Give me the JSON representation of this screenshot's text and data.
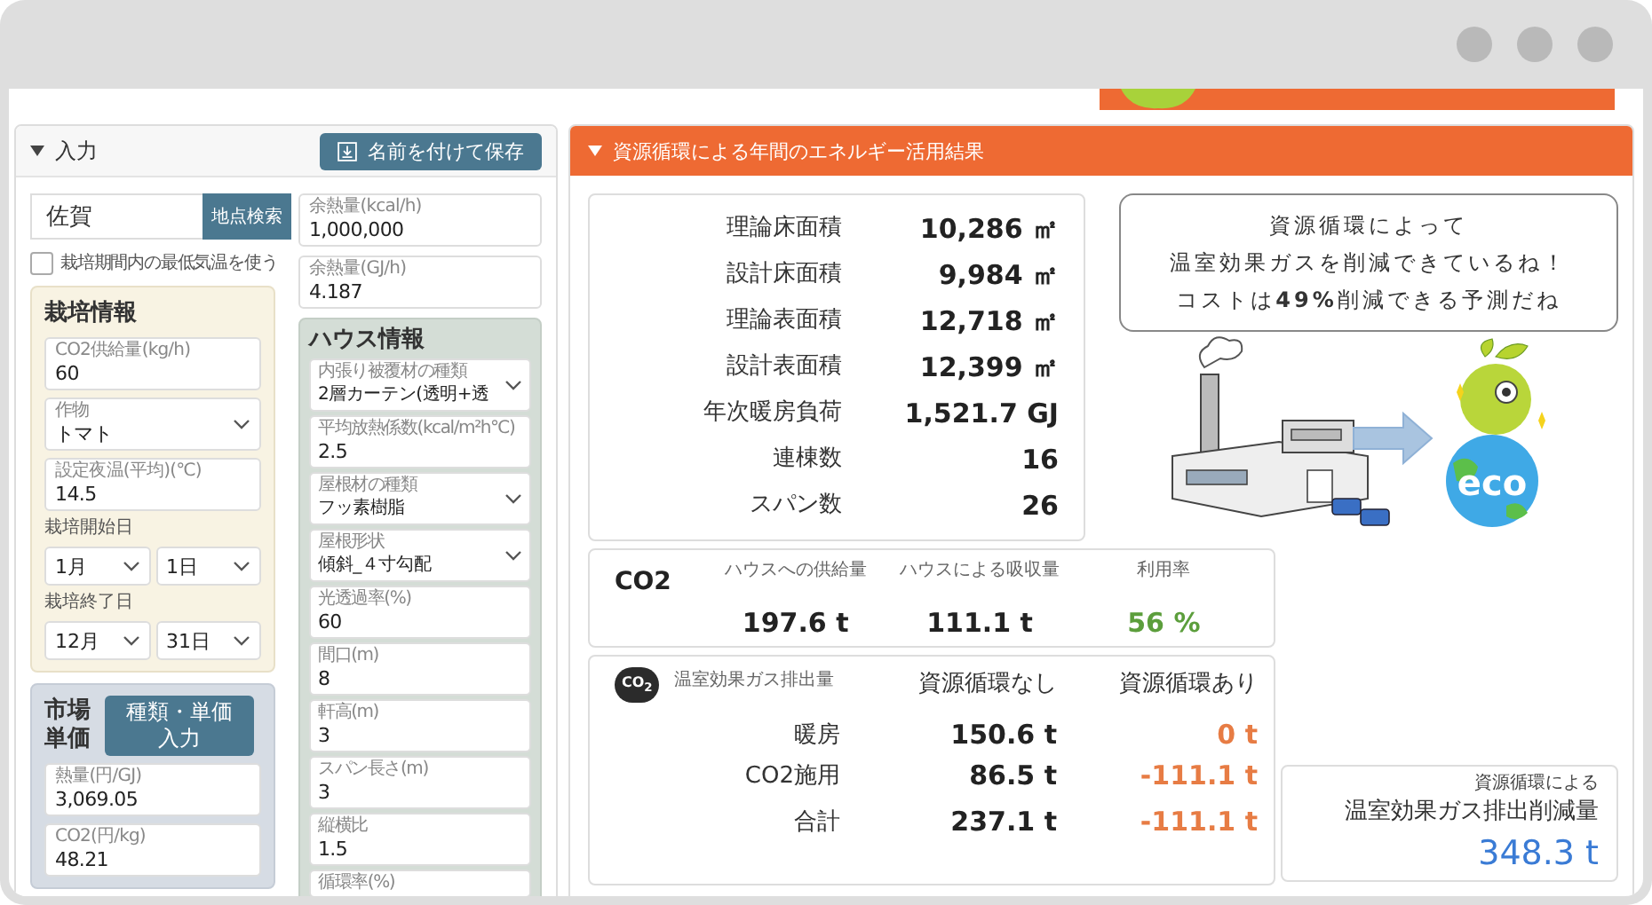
{
  "input_panel": {
    "title": "入力",
    "save_button": "名前を付けて保存",
    "location": {
      "value": "佐賀",
      "button": "地点検索"
    },
    "min_temp_checkbox": {
      "label": "栽培期間内の最低気温を使う",
      "checked": false
    },
    "waste_heat": [
      {
        "kind": "input",
        "label": "余熱量(kcal/h)",
        "value": "1,000,000"
      },
      {
        "kind": "input",
        "label": "余熱量(GJ/h)",
        "value": "4.187"
      }
    ],
    "cultivation": {
      "title": "栽培情報",
      "fields": [
        {
          "kind": "input",
          "label": "CO2供給量(kg/h)",
          "value": "60"
        },
        {
          "kind": "select",
          "label": "作物",
          "value": "トマト"
        },
        {
          "kind": "input",
          "label": "設定夜温(平均)(℃)",
          "value": "14.5"
        }
      ],
      "start": {
        "label": "栽培開始日",
        "month": "1月",
        "day": "1日"
      },
      "end": {
        "label": "栽培終了日",
        "month": "12月",
        "day": "31日"
      }
    },
    "market": {
      "title": "市場単価",
      "button": "種類・単価入力",
      "fields": [
        {
          "kind": "input",
          "label": "熱量(円/GJ)",
          "value": "3,069.05"
        },
        {
          "kind": "input",
          "label": "CO2(円/kg)",
          "value": "48.21"
        }
      ]
    },
    "house": {
      "title": "ハウス情報",
      "fields": [
        {
          "kind": "select",
          "label": "内張り被覆材の種類",
          "value": "2層カーテン(透明+透"
        },
        {
          "kind": "input",
          "label": "平均放熱係数(kcal/m²h℃)",
          "value": "2.5"
        },
        {
          "kind": "select",
          "label": "屋根材の種類",
          "value": "フッ素樹脂"
        },
        {
          "kind": "select",
          "label": "屋根形状",
          "value": "傾斜_４寸勾配"
        },
        {
          "kind": "input",
          "label": "光透過率(%)",
          "value": "60"
        },
        {
          "kind": "input",
          "label": "間口(m)",
          "value": "8"
        },
        {
          "kind": "input",
          "label": "軒高(m)",
          "value": "3"
        },
        {
          "kind": "input",
          "label": "スパン長さ(m)",
          "value": "3"
        },
        {
          "kind": "input",
          "label": "縦横比",
          "value": "1.5"
        },
        {
          "kind": "input",
          "label": "循環率(%)"
        }
      ]
    }
  },
  "results": {
    "title": "資源循環による年間のエネルギー活用結果",
    "stats": [
      {
        "label": "理論床面積",
        "value": "10,286 ㎡"
      },
      {
        "label": "設計床面積",
        "value": "9,984 ㎡"
      },
      {
        "label": "理論表面積",
        "value": "12,718 ㎡"
      },
      {
        "label": "設計表面積",
        "value": "12,399 ㎡"
      },
      {
        "label": "年次暖房負荷",
        "value": "1,521.7 GJ"
      },
      {
        "label": "連棟数",
        "value": "16"
      },
      {
        "label": "スパン数",
        "value": "26"
      }
    ],
    "message": [
      "資源循環によって",
      "温室効果ガスを削減できているね！",
      "コストは**49%**削減できる予測だね"
    ],
    "globe_text": "eco",
    "co2": {
      "title": "CO2",
      "columns": [
        {
          "label": "ハウスへの供給量",
          "value": "197.6 t",
          "color": "#222222"
        },
        {
          "label": "ハウスによる吸収量",
          "value": "111.1 t",
          "color": "#222222"
        },
        {
          "label": "利用率",
          "value": "56 %",
          "color": "#5c9e3c"
        }
      ]
    },
    "emissions": {
      "icon_label": "CO$_{2}$",
      "title": "温室効果ガス排出量",
      "columns": [
        "資源循環なし",
        "資源循環あり"
      ],
      "rows": [
        {
          "label": "暖房",
          "without": "150.6 t",
          "with": "0 t"
        },
        {
          "label": "CO2施用",
          "without": "86.5 t",
          "with": "-111.1 t"
        },
        {
          "label": "合計",
          "without": "237.1 t",
          "with": "-111.1 t"
        }
      ]
    },
    "reduction": {
      "caption": "資源循環による",
      "title": "温室効果ガス排出削減量",
      "value": "348.3 t"
    }
  }
}
